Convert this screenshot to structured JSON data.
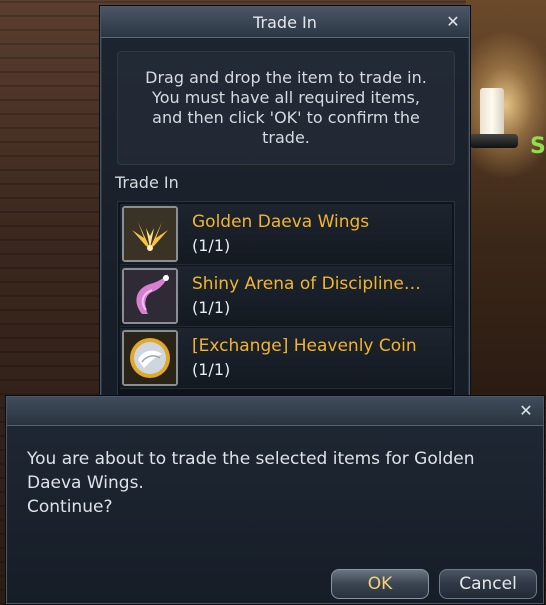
{
  "trade_window": {
    "title": "Trade In",
    "close_glyph": "✕",
    "instructions": "Drag and drop the item to trade in.\nYou must have all required items,\nand then click 'OK' to confirm the\ntrade.",
    "section_label": "Trade In",
    "items": [
      {
        "name": "Golden Daeva Wings",
        "qty": "(1/1)",
        "icon": "golden-wings-icon"
      },
      {
        "name": "Shiny Arena of Discipline…",
        "qty": "(1/1)",
        "icon": "arena-ticket-icon"
      },
      {
        "name": "[Exchange] Heavenly Coin",
        "qty": "(1/1)",
        "icon": "heavenly-coin-icon"
      }
    ]
  },
  "confirm_dialog": {
    "close_glyph": "✕",
    "message": "You are about to trade the selected items for Golden\nDaeva Wings.\nContinue?",
    "ok_label": "OK",
    "cancel_label": "Cancel"
  },
  "background": {
    "corner_text": "S",
    "corner_text_color": "#8fe04a"
  },
  "colors": {
    "item_name": "#f3b52b",
    "ok_text": "#f4d27a"
  }
}
